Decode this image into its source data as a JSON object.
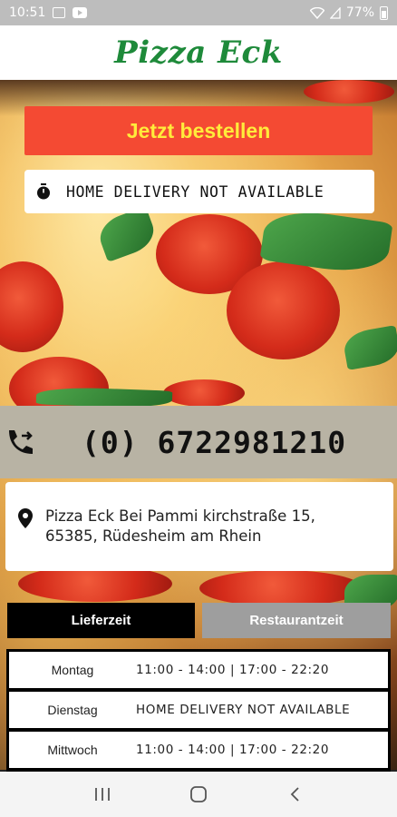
{
  "status_bar": {
    "time": "10:51",
    "battery": "77%",
    "icons": [
      "image-icon",
      "youtube-icon",
      "wifi-icon",
      "signal-icon",
      "battery-icon"
    ]
  },
  "header": {
    "logo_text": "Pizza Eck",
    "logo_color": "#1e8a3a"
  },
  "order_button": {
    "label": "Jetzt bestellen",
    "bg_color": "#f44a33",
    "text_color": "#ffeb3b"
  },
  "delivery_notice": {
    "icon": "timer-icon",
    "text": "HOME DELIVERY NOT AVAILABLE"
  },
  "phone": {
    "icon": "phone-forward-icon",
    "number": "(0) 6722981210"
  },
  "address": {
    "icon": "location-pin-icon",
    "line1": "Pizza Eck Bei Pammi kirchstraße 15,",
    "line2": "65385, Rüdesheim am Rhein"
  },
  "tabs": [
    {
      "label": "Lieferzeit",
      "active": true
    },
    {
      "label": "Restaurantzeit",
      "active": false
    }
  ],
  "hours": [
    {
      "day": "Montag",
      "time": "11:00 - 14:00 | 17:00 - 22:20"
    },
    {
      "day": "Dienstag",
      "time": "HOME DELIVERY NOT AVAILABLE"
    },
    {
      "day": "Mittwoch",
      "time": "11:00 - 14:00 | 17:00 - 22:20"
    }
  ],
  "nav_bar": {
    "icons": [
      "recent-apps-icon",
      "home-icon",
      "back-icon"
    ]
  }
}
